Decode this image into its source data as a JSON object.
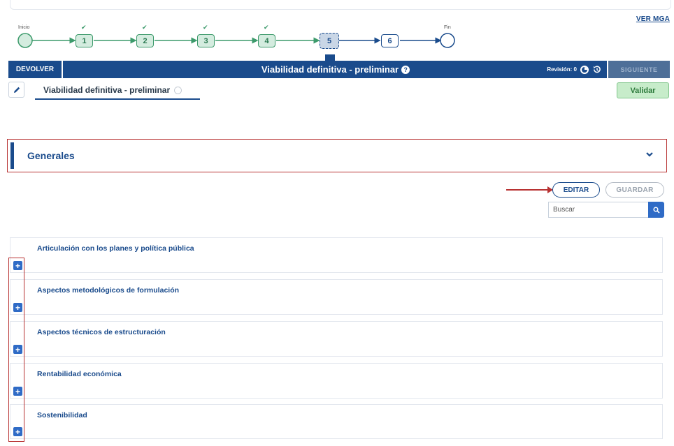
{
  "header": {
    "ver_mga": "VER MGA"
  },
  "stepper": {
    "start_label": "Inicio",
    "end_label": "Fin",
    "steps": [
      {
        "number": "1",
        "state": "done",
        "check": "✔"
      },
      {
        "number": "2",
        "state": "done",
        "check": "✔"
      },
      {
        "number": "3",
        "state": "done",
        "check": "✔"
      },
      {
        "number": "4",
        "state": "done",
        "check": "✔"
      },
      {
        "number": "5",
        "state": "current",
        "check": ""
      },
      {
        "number": "6",
        "state": "pending",
        "check": ""
      }
    ]
  },
  "phase_bar": {
    "devolver": "DEVOLVER",
    "title": "Viabilidad definitiva - preliminar",
    "help_glyph": "?",
    "revision": "Revisión: 0",
    "siguiente": "SIGUIENTE"
  },
  "subtab": {
    "label": "Viabilidad definitiva - preliminar",
    "validar": "Validar"
  },
  "generales": {
    "title": "Generales",
    "chevron": "⌄"
  },
  "actions": {
    "editar": "EDITAR",
    "guardar": "GUARDAR",
    "search_placeholder": "Buscar"
  },
  "sections": [
    {
      "label": "Articulación con los planes y política pública"
    },
    {
      "label": "Aspectos metodológicos de formulación"
    },
    {
      "label": "Aspectos técnicos de estructuración"
    },
    {
      "label": "Rentabilidad económica"
    },
    {
      "label": "Sostenibilidad"
    }
  ],
  "colors": {
    "primary": "#1a4b8c",
    "done_green": "#3c9a6b",
    "highlight_red": "#b83232",
    "validar_bg": "#c7ecca"
  }
}
